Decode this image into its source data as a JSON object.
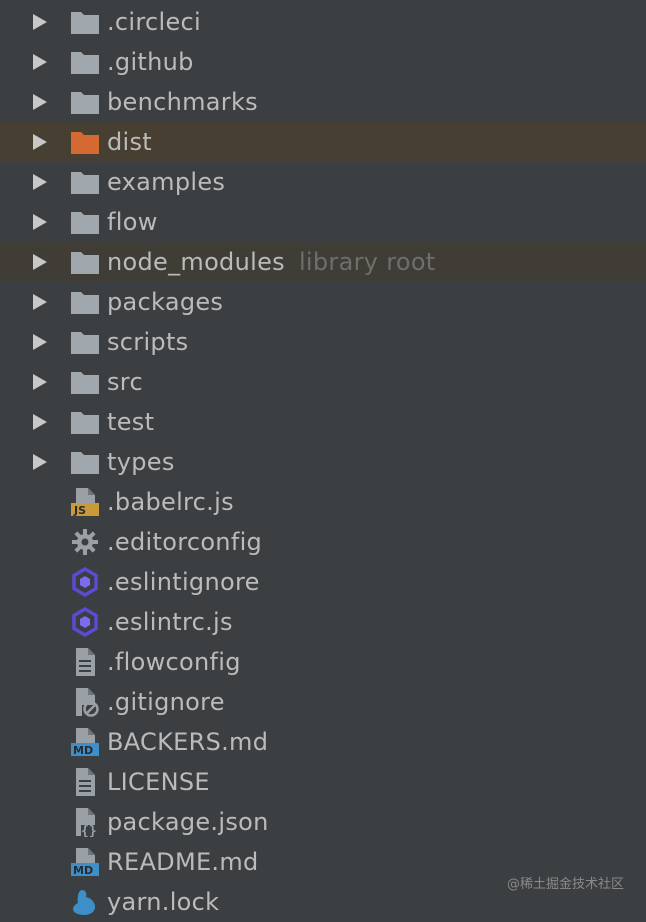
{
  "colors": {
    "background": "#3c3f41",
    "text": "#bbbbbb",
    "folder": "#a0a8ae",
    "excluded_folder": "#d46a32",
    "hint": "#6e6e6e",
    "highlight": "#463f32"
  },
  "tree": {
    "folders": [
      {
        "label": ".circleci",
        "icon": "folder-icon"
      },
      {
        "label": ".github",
        "icon": "folder-icon"
      },
      {
        "label": "benchmarks",
        "icon": "folder-icon"
      },
      {
        "label": "dist",
        "icon": "excluded-folder-icon"
      },
      {
        "label": "examples",
        "icon": "folder-icon"
      },
      {
        "label": "flow",
        "icon": "folder-icon"
      },
      {
        "label": "node_modules",
        "hint": "library root",
        "icon": "folder-icon"
      },
      {
        "label": "packages",
        "icon": "folder-icon"
      },
      {
        "label": "scripts",
        "icon": "folder-icon"
      },
      {
        "label": "src",
        "icon": "folder-icon"
      },
      {
        "label": "test",
        "icon": "folder-icon"
      },
      {
        "label": "types",
        "icon": "folder-icon"
      }
    ],
    "files": [
      {
        "label": ".babelrc.js",
        "icon": "js-file-icon",
        "badge": "JS"
      },
      {
        "label": ".editorconfig",
        "icon": "gear-icon"
      },
      {
        "label": ".eslintignore",
        "icon": "eslint-icon"
      },
      {
        "label": ".eslintrc.js",
        "icon": "eslint-icon"
      },
      {
        "label": ".flowconfig",
        "icon": "text-file-icon"
      },
      {
        "label": ".gitignore",
        "icon": "ignore-file-icon"
      },
      {
        "label": "BACKERS.md",
        "icon": "markdown-file-icon",
        "badge": "MD"
      },
      {
        "label": "LICENSE",
        "icon": "text-file-icon"
      },
      {
        "label": "package.json",
        "icon": "json-file-icon",
        "badge": "{}"
      },
      {
        "label": "README.md",
        "icon": "markdown-file-icon",
        "badge": "MD"
      },
      {
        "label": "yarn.lock",
        "icon": "yarn-icon"
      }
    ]
  },
  "watermark": "@稀土掘金技术社区"
}
